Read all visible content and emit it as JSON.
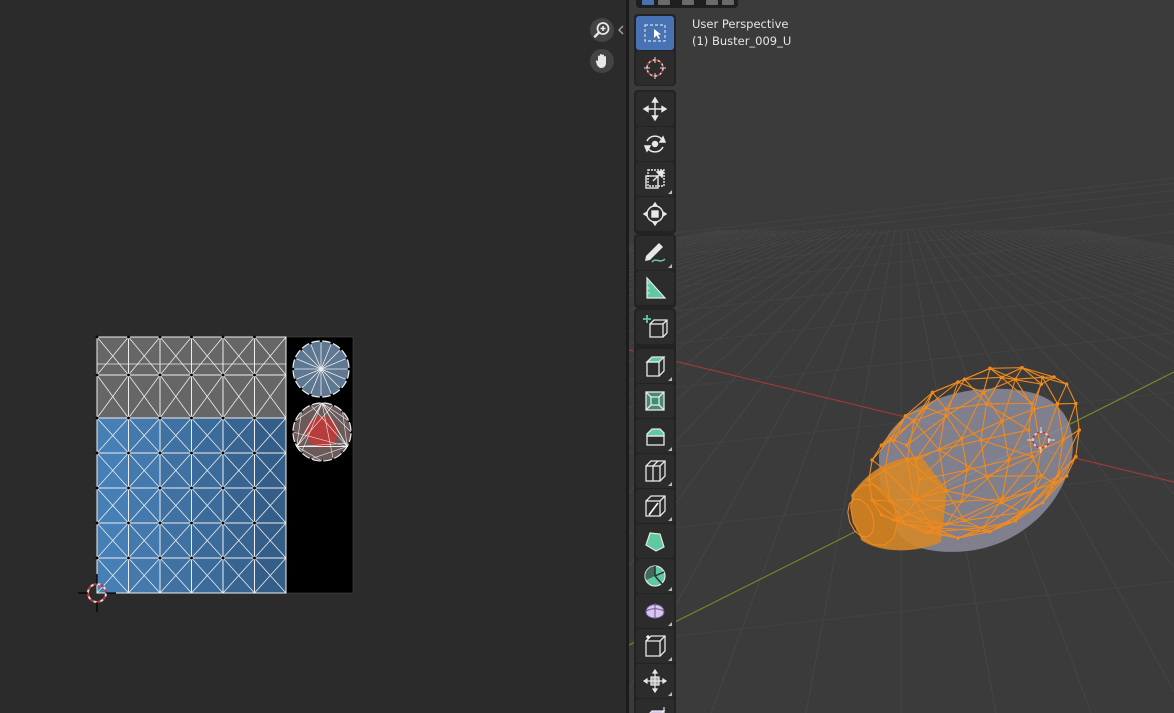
{
  "viewport": {
    "title": "User Perspective",
    "object_name": "(1) Buster_009_U"
  },
  "uv_editor": {
    "navigation": {
      "zoom_icon": "zoom-icon",
      "pan_icon": "hand-pan-icon"
    },
    "layout": {
      "grid_columns": 6,
      "grid_rows": 7,
      "blue_rows": 5,
      "gray_rows": 2,
      "circle_segments": 16
    },
    "colors": {
      "uv_background": "#000000",
      "gray_face": "#666666",
      "blue_face": "#4a86c0",
      "circle_face": "#5e7891",
      "red_face": "#c43838"
    }
  },
  "toolbar": {
    "tools": [
      {
        "name": "select-box",
        "icon": "select-box-icon",
        "active": true
      },
      {
        "name": "cursor",
        "icon": "cursor-icon"
      },
      {
        "name": "move",
        "icon": "move-icon"
      },
      {
        "name": "rotate",
        "icon": "rotate-icon"
      },
      {
        "name": "scale",
        "icon": "scale-icon"
      },
      {
        "name": "transform",
        "icon": "transform-icon"
      },
      {
        "name": "annotate",
        "icon": "annotate-icon"
      },
      {
        "name": "measure",
        "icon": "measure-icon"
      },
      {
        "name": "add-cube",
        "icon": "add-cube-icon"
      },
      {
        "name": "extrude",
        "icon": "extrude-icon"
      },
      {
        "name": "inset",
        "icon": "inset-icon"
      },
      {
        "name": "bevel",
        "icon": "bevel-icon"
      },
      {
        "name": "loop-cut",
        "icon": "loop-cut-icon"
      },
      {
        "name": "knife",
        "icon": "knife-icon"
      },
      {
        "name": "poly-build",
        "icon": "poly-build-icon"
      },
      {
        "name": "spin",
        "icon": "spin-icon"
      },
      {
        "name": "smooth",
        "icon": "smooth-icon"
      },
      {
        "name": "edge-slide",
        "icon": "edge-slide-icon"
      },
      {
        "name": "shrink-fatten",
        "icon": "shrink-fatten-icon"
      },
      {
        "name": "shear",
        "icon": "shear-icon"
      }
    ]
  },
  "mesh": {
    "edge_color": "#f08a1e",
    "surface_color": "#8c8c9c",
    "axis_x_color": "#9b3a3a",
    "axis_y_color": "#6c8c2a"
  }
}
